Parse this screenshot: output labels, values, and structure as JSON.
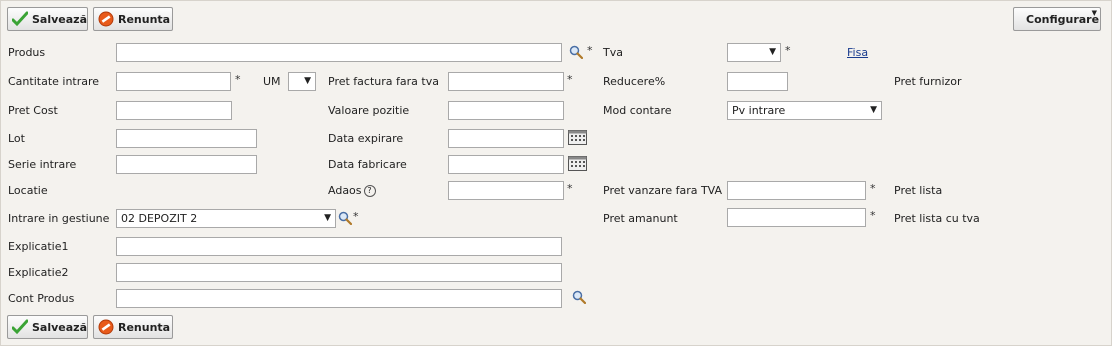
{
  "toolbar": {
    "save_label": "Salvează",
    "cancel_label": "Renunta",
    "config_label": "Configurare"
  },
  "form": {
    "produs_label": "Produs",
    "tva_label": "Tva",
    "fisa_link": "Fisa",
    "cantitate_label": "Cantitate intrare",
    "um_label": "UM",
    "pret_factura_label": "Pret factura fara tva",
    "reducere_label": "Reducere%",
    "pret_furnizor_label": "Pret furnizor",
    "pret_cost_label": "Pret Cost",
    "valoare_pozitie_label": "Valoare pozitie",
    "mod_contare_label": "Mod contare",
    "mod_contare_value": "Pv intrare",
    "lot_label": "Lot",
    "data_expirare_label": "Data expirare",
    "serie_label": "Serie intrare",
    "data_fabricare_label": "Data fabricare",
    "locatie_label": "Locatie",
    "adaos_label": "Adaos",
    "help_glyph": "?",
    "pret_vanzare_label": "Pret vanzare fara TVA",
    "pret_lista_label": "Pret lista",
    "intrare_gestiune_label": "Intrare in gestiune",
    "intrare_gestiune_value": "02 DEPOZIT 2",
    "pret_amanunt_label": "Pret amanunt",
    "pret_lista_tva_label": "Pret lista cu tva",
    "explicatie1_label": "Explicatie1",
    "explicatie2_label": "Explicatie2",
    "cont_produs_label": "Cont Produs",
    "required_mark": "*",
    "dropdown_arrow": "▼"
  }
}
